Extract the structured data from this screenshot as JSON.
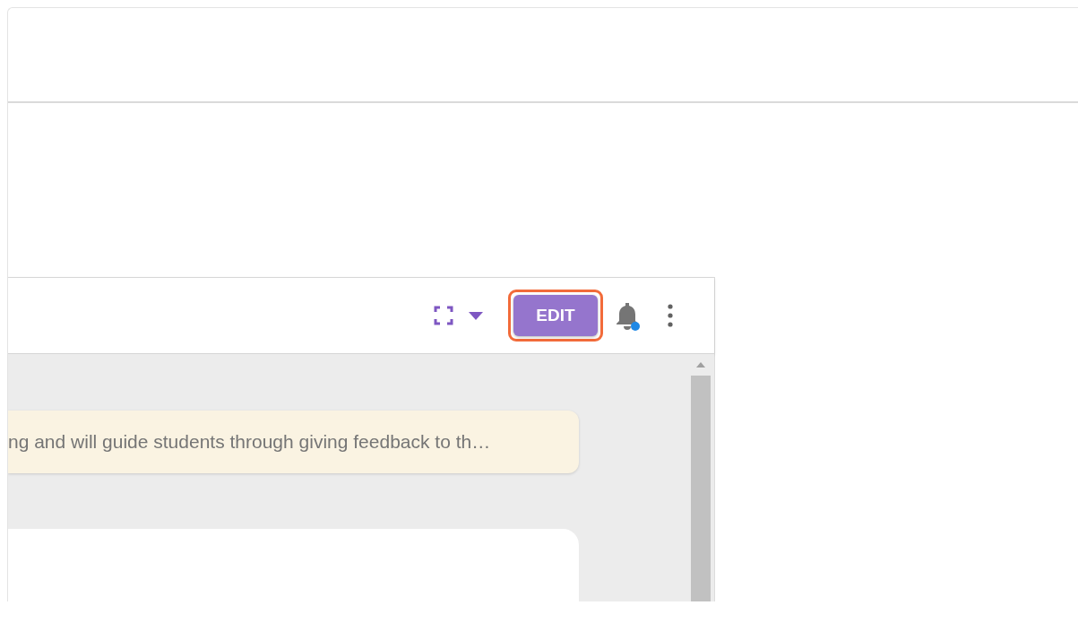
{
  "toolbar": {
    "edit_button": "EDIT",
    "edit_highlighted": true,
    "notification_unread": true
  },
  "banner": {
    "text": "ng and will guide students through giving feedback to th…"
  }
}
